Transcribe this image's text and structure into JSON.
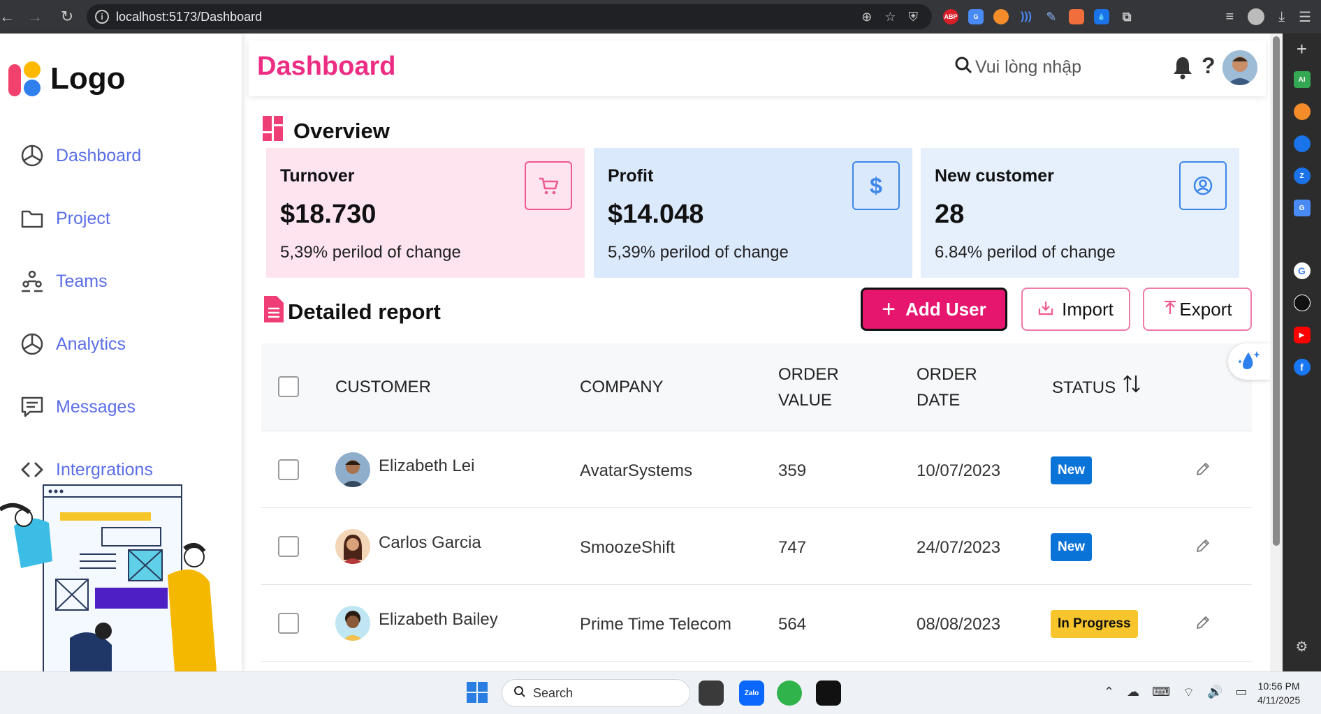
{
  "browser": {
    "url": "localhost:5173/Dashboard"
  },
  "sidebar": {
    "logo_text": "Logo",
    "items": [
      {
        "label": "Dashboard",
        "icon": "pie-chart-icon"
      },
      {
        "label": "Project",
        "icon": "folder-icon"
      },
      {
        "label": "Teams",
        "icon": "users-icon"
      },
      {
        "label": "Analytics",
        "icon": "pie-chart-icon"
      },
      {
        "label": "Messages",
        "icon": "message-icon"
      },
      {
        "label": "Intergrations",
        "icon": "code-icon"
      }
    ]
  },
  "header": {
    "title": "Dashboard",
    "search_placeholder": "Vui lòng nhập",
    "help_glyph": "?"
  },
  "overview": {
    "title": "Overview",
    "cards": [
      {
        "title": "Turnover",
        "value": "$18.730",
        "change": "5,39% perilod of change",
        "icon": "cart-icon",
        "bg": "#fde4ef",
        "accent": "#f0598d"
      },
      {
        "title": "Profit",
        "value": "$14.048",
        "change": "5,39% perilod of change",
        "icon": "dollar-icon",
        "bg": "#dbe9fd",
        "accent": "#3d86e8"
      },
      {
        "title": "New customer",
        "value": "28",
        "change": "6.84% perilod of change",
        "icon": "user-circle-icon",
        "bg": "#e6f0fd",
        "accent": "#3d86e8"
      }
    ]
  },
  "report": {
    "title": "Detailed report",
    "add_user_label": "Add User",
    "import_label": "Import",
    "export_label": "Export",
    "columns": {
      "customer": "CUSTOMER",
      "company": "COMPANY",
      "order_value_1": "ORDER",
      "order_value_2": "VALUE",
      "order_date_1": "ORDER",
      "order_date_2": "DATE",
      "status": "STATUS"
    },
    "rows": [
      {
        "customer": "Elizabeth Lei",
        "company": "AvatarSystems",
        "order_value": "359",
        "order_date": "10/07/2023",
        "status": "New"
      },
      {
        "customer": "Carlos Garcia",
        "company": "SmoozeShift",
        "order_value": "747",
        "order_date": "24/07/2023",
        "status": "New"
      },
      {
        "customer": "Elizabeth Bailey",
        "company": "Prime Time Telecom",
        "order_value": "564",
        "order_date": "08/08/2023",
        "status": "In Progress"
      }
    ]
  },
  "colors": {
    "brand_pink": "#ec2d83",
    "menu_blue": "#5a6ee8",
    "status_new": "#0a73d8",
    "status_progress": "#f9c52c"
  },
  "taskbar": {
    "search_label": "Search",
    "time": "10:56 PM",
    "date": "4/11/2025"
  }
}
